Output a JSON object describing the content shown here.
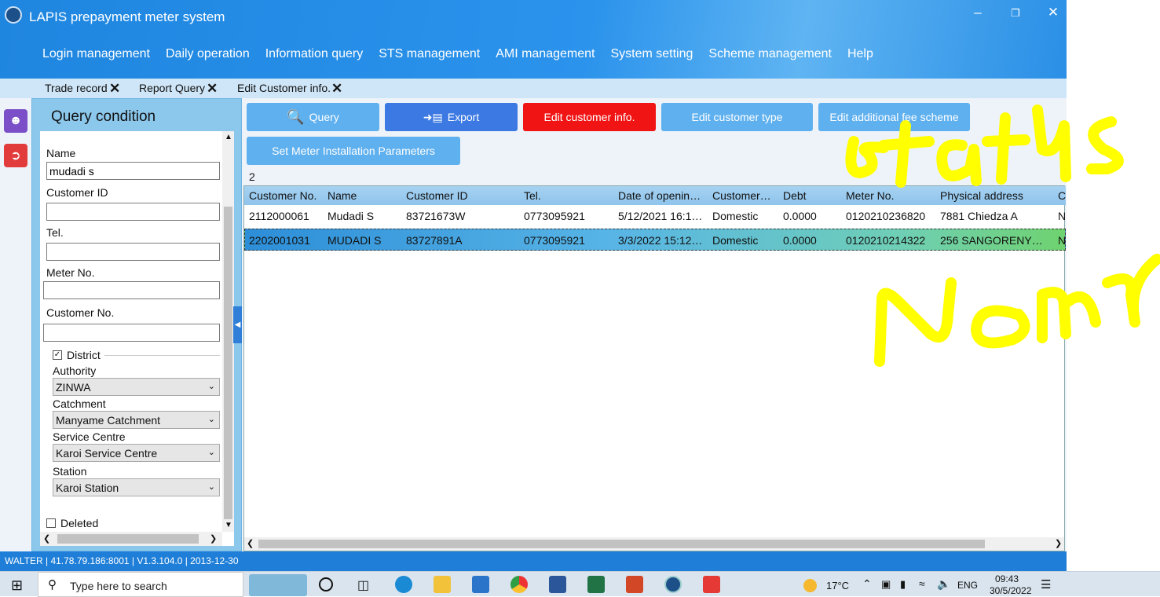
{
  "app": {
    "title": "LAPIS prepayment meter system"
  },
  "menu": [
    "Login management",
    "Daily operation",
    "Information query",
    "STS management",
    "AMI management",
    "System setting",
    "Scheme management",
    "Help"
  ],
  "tabs": [
    {
      "label": "Trade record"
    },
    {
      "label": "Report Query"
    },
    {
      "label": "Edit Customer info."
    }
  ],
  "query": {
    "title": "Query condition",
    "name_label": "Name",
    "name_value": "mudadi s",
    "customer_id_label": "Customer ID",
    "tel_label": "Tel.",
    "meter_label": "Meter No.",
    "customer_no_label": "Customer No.",
    "district_label": "District",
    "authority_label": "Authority",
    "authority_value": "ZINWA",
    "catchment_label": "Catchment",
    "catchment_value": "Manyame Catchment",
    "service_label": "Service Centre",
    "service_value": "Karoi Service Centre",
    "station_label": "Station",
    "station_value": "Karoi Station",
    "deleted_label": "Deleted"
  },
  "toolbar": {
    "query": "Query",
    "export": "Export",
    "edit_info": "Edit customer info.",
    "edit_type": "Edit customer type",
    "edit_fee": "Edit additional fee scheme",
    "set_meter": "Set Meter Installation Parameters"
  },
  "result_count": "2",
  "table": {
    "headers": [
      "Customer No.",
      "Name",
      "Customer ID",
      "Tel.",
      "Date of openin…",
      "Customer…",
      "Debt",
      "Meter No.",
      "Physical address",
      "C"
    ],
    "rows": [
      [
        "2112000061",
        "Mudadi S",
        "83721673W",
        "0773095921",
        "5/12/2021 16:1…",
        "Domestic",
        "0.0000",
        "0120210236820",
        "7881 Chiedza A",
        "N"
      ],
      [
        "2202001031",
        "MUDADI S",
        "83727891A",
        "0773095921",
        "3/3/2022 15:12…",
        "Domestic",
        "0.0000",
        "0120210214322",
        "256  SANGORENY…",
        "N"
      ]
    ]
  },
  "status": "WALTER  |  41.78.79.186:8001  |  V1.3.104.0  |  2013-12-30",
  "taskbar": {
    "search_placeholder": "Type here to search",
    "temp": "17°C",
    "lang": "ENG",
    "time": "09:43",
    "date": "30/5/2022"
  },
  "colors": {
    "title_blue": "#2b93ec",
    "red": "#f01414",
    "scribble": "#ffff00"
  }
}
